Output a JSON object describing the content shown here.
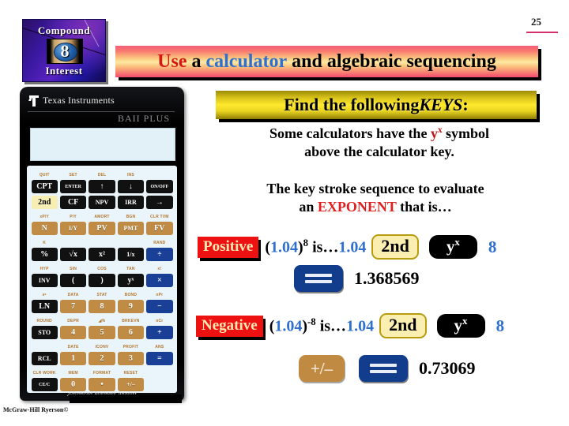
{
  "page": {
    "number": "25"
  },
  "logo": {
    "top_text": "Compound",
    "bottom_text": "Interest",
    "chapter_number": "8"
  },
  "banner": {
    "word_use": "Use",
    "word_a": "a",
    "word_calculator": "calculator",
    "word_rest": "and algebraic sequencing"
  },
  "keys_box": {
    "text_plain": "Find the following ",
    "text_italic": "KEYS",
    "text_colon": ":"
  },
  "paragraph_1": {
    "line1_a": "Some calculators have the ",
    "symbol_y": "y",
    "symbol_x": "x",
    "line1_b": " symbol",
    "line2": "above the calculator key."
  },
  "paragraph_2": {
    "line1": "The key stroke sequence to evaluate",
    "line2_a": "an ",
    "line2_red": "EXPONENT",
    "line2_b": " that is…"
  },
  "positive_row": {
    "badge": "Positive",
    "open_paren": "(",
    "base": "1.04",
    "close_paren": ")",
    "exponent": "8",
    "is_text": " is…",
    "entry": "1.04",
    "key_2nd": "2nd",
    "key_y": "y",
    "key_x": "x",
    "key_exp": "8",
    "result": "1.368569"
  },
  "negative_row": {
    "badge": "Negative",
    "open_paren": "(",
    "base": "1.04",
    "close_paren": ")",
    "exponent": "-8",
    "is_text": " is…",
    "entry": "1.04",
    "key_2nd": "2nd",
    "key_y": "y",
    "key_x": "x",
    "key_exp": "8",
    "key_plusminus": "+/–",
    "result": "0.73069"
  },
  "calculator": {
    "brand": "Texas Instruments",
    "model": "BAII PLUS",
    "tagline": "Advanced Business Analyst",
    "display_value": "",
    "rows": [
      {
        "type": "labels",
        "items": [
          "QUIT",
          "SET",
          "DEL",
          "INS",
          ""
        ]
      },
      {
        "type": "keys",
        "items": [
          {
            "label": "CPT",
            "style": "black"
          },
          {
            "label": "ENTER",
            "style": "black",
            "size": "tiny"
          },
          {
            "label": "↑",
            "style": "black"
          },
          {
            "label": "↓",
            "style": "black"
          },
          {
            "label": "ON/OFF",
            "style": "black",
            "size": "tiny"
          }
        ]
      },
      {
        "type": "keys",
        "items": [
          {
            "label": "2nd",
            "style": "second"
          },
          {
            "label": "CF",
            "style": "black"
          },
          {
            "label": "NPV",
            "style": "black",
            "size": "small"
          },
          {
            "label": "IRR",
            "style": "black",
            "size": "small"
          },
          {
            "label": "→",
            "style": "black"
          }
        ]
      },
      {
        "type": "labels",
        "items": [
          "xP/Y",
          "P/Y",
          "AMORT",
          "BGN",
          "CLR TVM"
        ]
      },
      {
        "type": "keys",
        "items": [
          {
            "label": "N",
            "style": "brown"
          },
          {
            "label": "I/Y",
            "style": "brown",
            "size": "small"
          },
          {
            "label": "PV",
            "style": "brown"
          },
          {
            "label": "PMT",
            "style": "brown",
            "size": "small"
          },
          {
            "label": "FV",
            "style": "brown"
          }
        ]
      },
      {
        "type": "labels",
        "items": [
          "K",
          "",
          "",
          "",
          "RAND"
        ]
      },
      {
        "type": "keys",
        "items": [
          {
            "label": "%",
            "style": "black"
          },
          {
            "label": "√x",
            "style": "black"
          },
          {
            "label": "x²",
            "style": "black"
          },
          {
            "label": "1/x",
            "style": "black",
            "size": "small"
          },
          {
            "label": "÷",
            "style": "blue"
          }
        ]
      },
      {
        "type": "labels",
        "items": [
          "HYP",
          "SIN",
          "COS",
          "TAN",
          "x!"
        ]
      },
      {
        "type": "keys",
        "items": [
          {
            "label": "INV",
            "style": "black",
            "size": "small"
          },
          {
            "label": "(",
            "style": "black"
          },
          {
            "label": ")",
            "style": "black"
          },
          {
            "label": "yˣ",
            "style": "black"
          },
          {
            "label": "×",
            "style": "blue"
          }
        ]
      },
      {
        "type": "labels",
        "items": [
          "eˣ",
          "DATA",
          "STAT",
          "BOND",
          "nPr"
        ]
      },
      {
        "type": "keys",
        "items": [
          {
            "label": "LN",
            "style": "black"
          },
          {
            "label": "7",
            "style": "brown"
          },
          {
            "label": "8",
            "style": "brown"
          },
          {
            "label": "9",
            "style": "brown"
          },
          {
            "label": "−",
            "style": "blue"
          }
        ]
      },
      {
        "type": "labels",
        "items": [
          "ROUND",
          "DEPR",
          "◢%",
          "BRKEVN",
          "nCr"
        ]
      },
      {
        "type": "keys",
        "items": [
          {
            "label": "STO",
            "style": "black",
            "size": "small"
          },
          {
            "label": "4",
            "style": "brown"
          },
          {
            "label": "5",
            "style": "brown"
          },
          {
            "label": "6",
            "style": "brown"
          },
          {
            "label": "+",
            "style": "blue"
          }
        ]
      },
      {
        "type": "labels",
        "items": [
          "",
          "DATE",
          "ICONV",
          "PROFIT",
          "ANS"
        ]
      },
      {
        "type": "keys",
        "items": [
          {
            "label": "RCL",
            "style": "black",
            "size": "small"
          },
          {
            "label": "1",
            "style": "brown"
          },
          {
            "label": "2",
            "style": "brown"
          },
          {
            "label": "3",
            "style": "brown"
          },
          {
            "label": "=",
            "style": "blue"
          }
        ]
      },
      {
        "type": "labels",
        "items": [
          "CLR WORK",
          "MEM",
          "FORMAT",
          "RESET",
          ""
        ]
      },
      {
        "type": "keys",
        "items": [
          {
            "label": "CE/C",
            "style": "black",
            "size": "tiny"
          },
          {
            "label": "0",
            "style": "brown"
          },
          {
            "label": "•",
            "style": "brown"
          },
          {
            "label": "+/–",
            "style": "brown",
            "size": "small"
          },
          {
            "label": "",
            "style": "none"
          }
        ]
      }
    ]
  },
  "footer": {
    "copyright": "McGraw-Hill Ryerson©"
  }
}
